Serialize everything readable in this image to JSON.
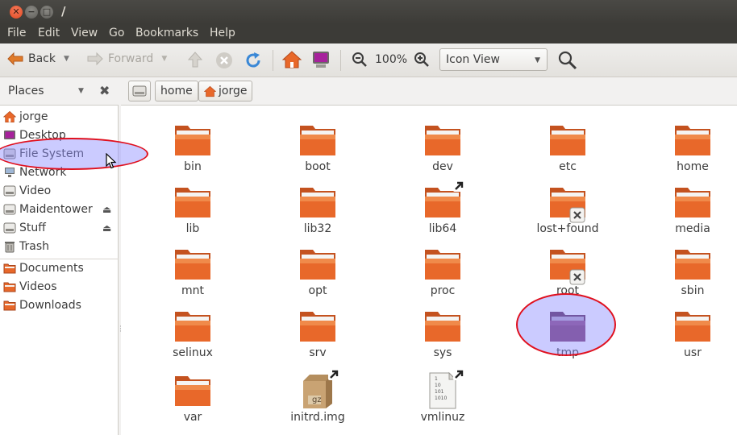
{
  "window": {
    "title": "/"
  },
  "menu": [
    "File",
    "Edit",
    "View",
    "Go",
    "Bookmarks",
    "Help"
  ],
  "toolbar": {
    "back_label": "Back",
    "forward_label": "Forward",
    "zoom_level": "100%",
    "view_mode": "Icon View"
  },
  "places": {
    "header": "Places"
  },
  "breadcrumbs": [
    "home",
    "jorge"
  ],
  "sidebar": {
    "items": [
      {
        "label": "jorge",
        "icon": "home-icon"
      },
      {
        "label": "Desktop",
        "icon": "desktop-icon"
      },
      {
        "label": "File System",
        "icon": "drive-icon"
      },
      {
        "label": "Network",
        "icon": "network-icon"
      },
      {
        "label": "Video",
        "icon": "drive-icon"
      },
      {
        "label": "Maidentower",
        "icon": "drive-icon"
      },
      {
        "label": "Stuff",
        "icon": "drive-icon"
      },
      {
        "label": "Trash",
        "icon": "trash-icon"
      },
      {
        "label": "Documents",
        "icon": "folder-icon"
      },
      {
        "label": "Videos",
        "icon": "folder-icon"
      },
      {
        "label": "Downloads",
        "icon": "folder-icon"
      }
    ]
  },
  "files": [
    {
      "name": "bin",
      "type": "folder"
    },
    {
      "name": "boot",
      "type": "folder"
    },
    {
      "name": "dev",
      "type": "folder"
    },
    {
      "name": "etc",
      "type": "folder"
    },
    {
      "name": "home",
      "type": "folder"
    },
    {
      "name": "lib",
      "type": "folder"
    },
    {
      "name": "lib32",
      "type": "folder"
    },
    {
      "name": "lib64",
      "type": "folder-link"
    },
    {
      "name": "lost+found",
      "type": "folder-locked"
    },
    {
      "name": "media",
      "type": "folder"
    },
    {
      "name": "mnt",
      "type": "folder"
    },
    {
      "name": "opt",
      "type": "folder"
    },
    {
      "name": "proc",
      "type": "folder"
    },
    {
      "name": "root",
      "type": "folder-locked"
    },
    {
      "name": "sbin",
      "type": "folder"
    },
    {
      "name": "selinux",
      "type": "folder"
    },
    {
      "name": "srv",
      "type": "folder"
    },
    {
      "name": "sys",
      "type": "folder"
    },
    {
      "name": "tmp",
      "type": "folder-selected"
    },
    {
      "name": "usr",
      "type": "folder"
    },
    {
      "name": "var",
      "type": "folder"
    },
    {
      "name": "initrd.img",
      "type": "archive-link",
      "icon_text": "gz"
    },
    {
      "name": "vmlinuz",
      "type": "binary-link",
      "icon_text": "1\n10\n101\n1010"
    }
  ],
  "colors": {
    "folder": "#e8682a",
    "accent": "#dd4814",
    "annotation": "#e0101e",
    "highlight": "#8c8cff"
  }
}
